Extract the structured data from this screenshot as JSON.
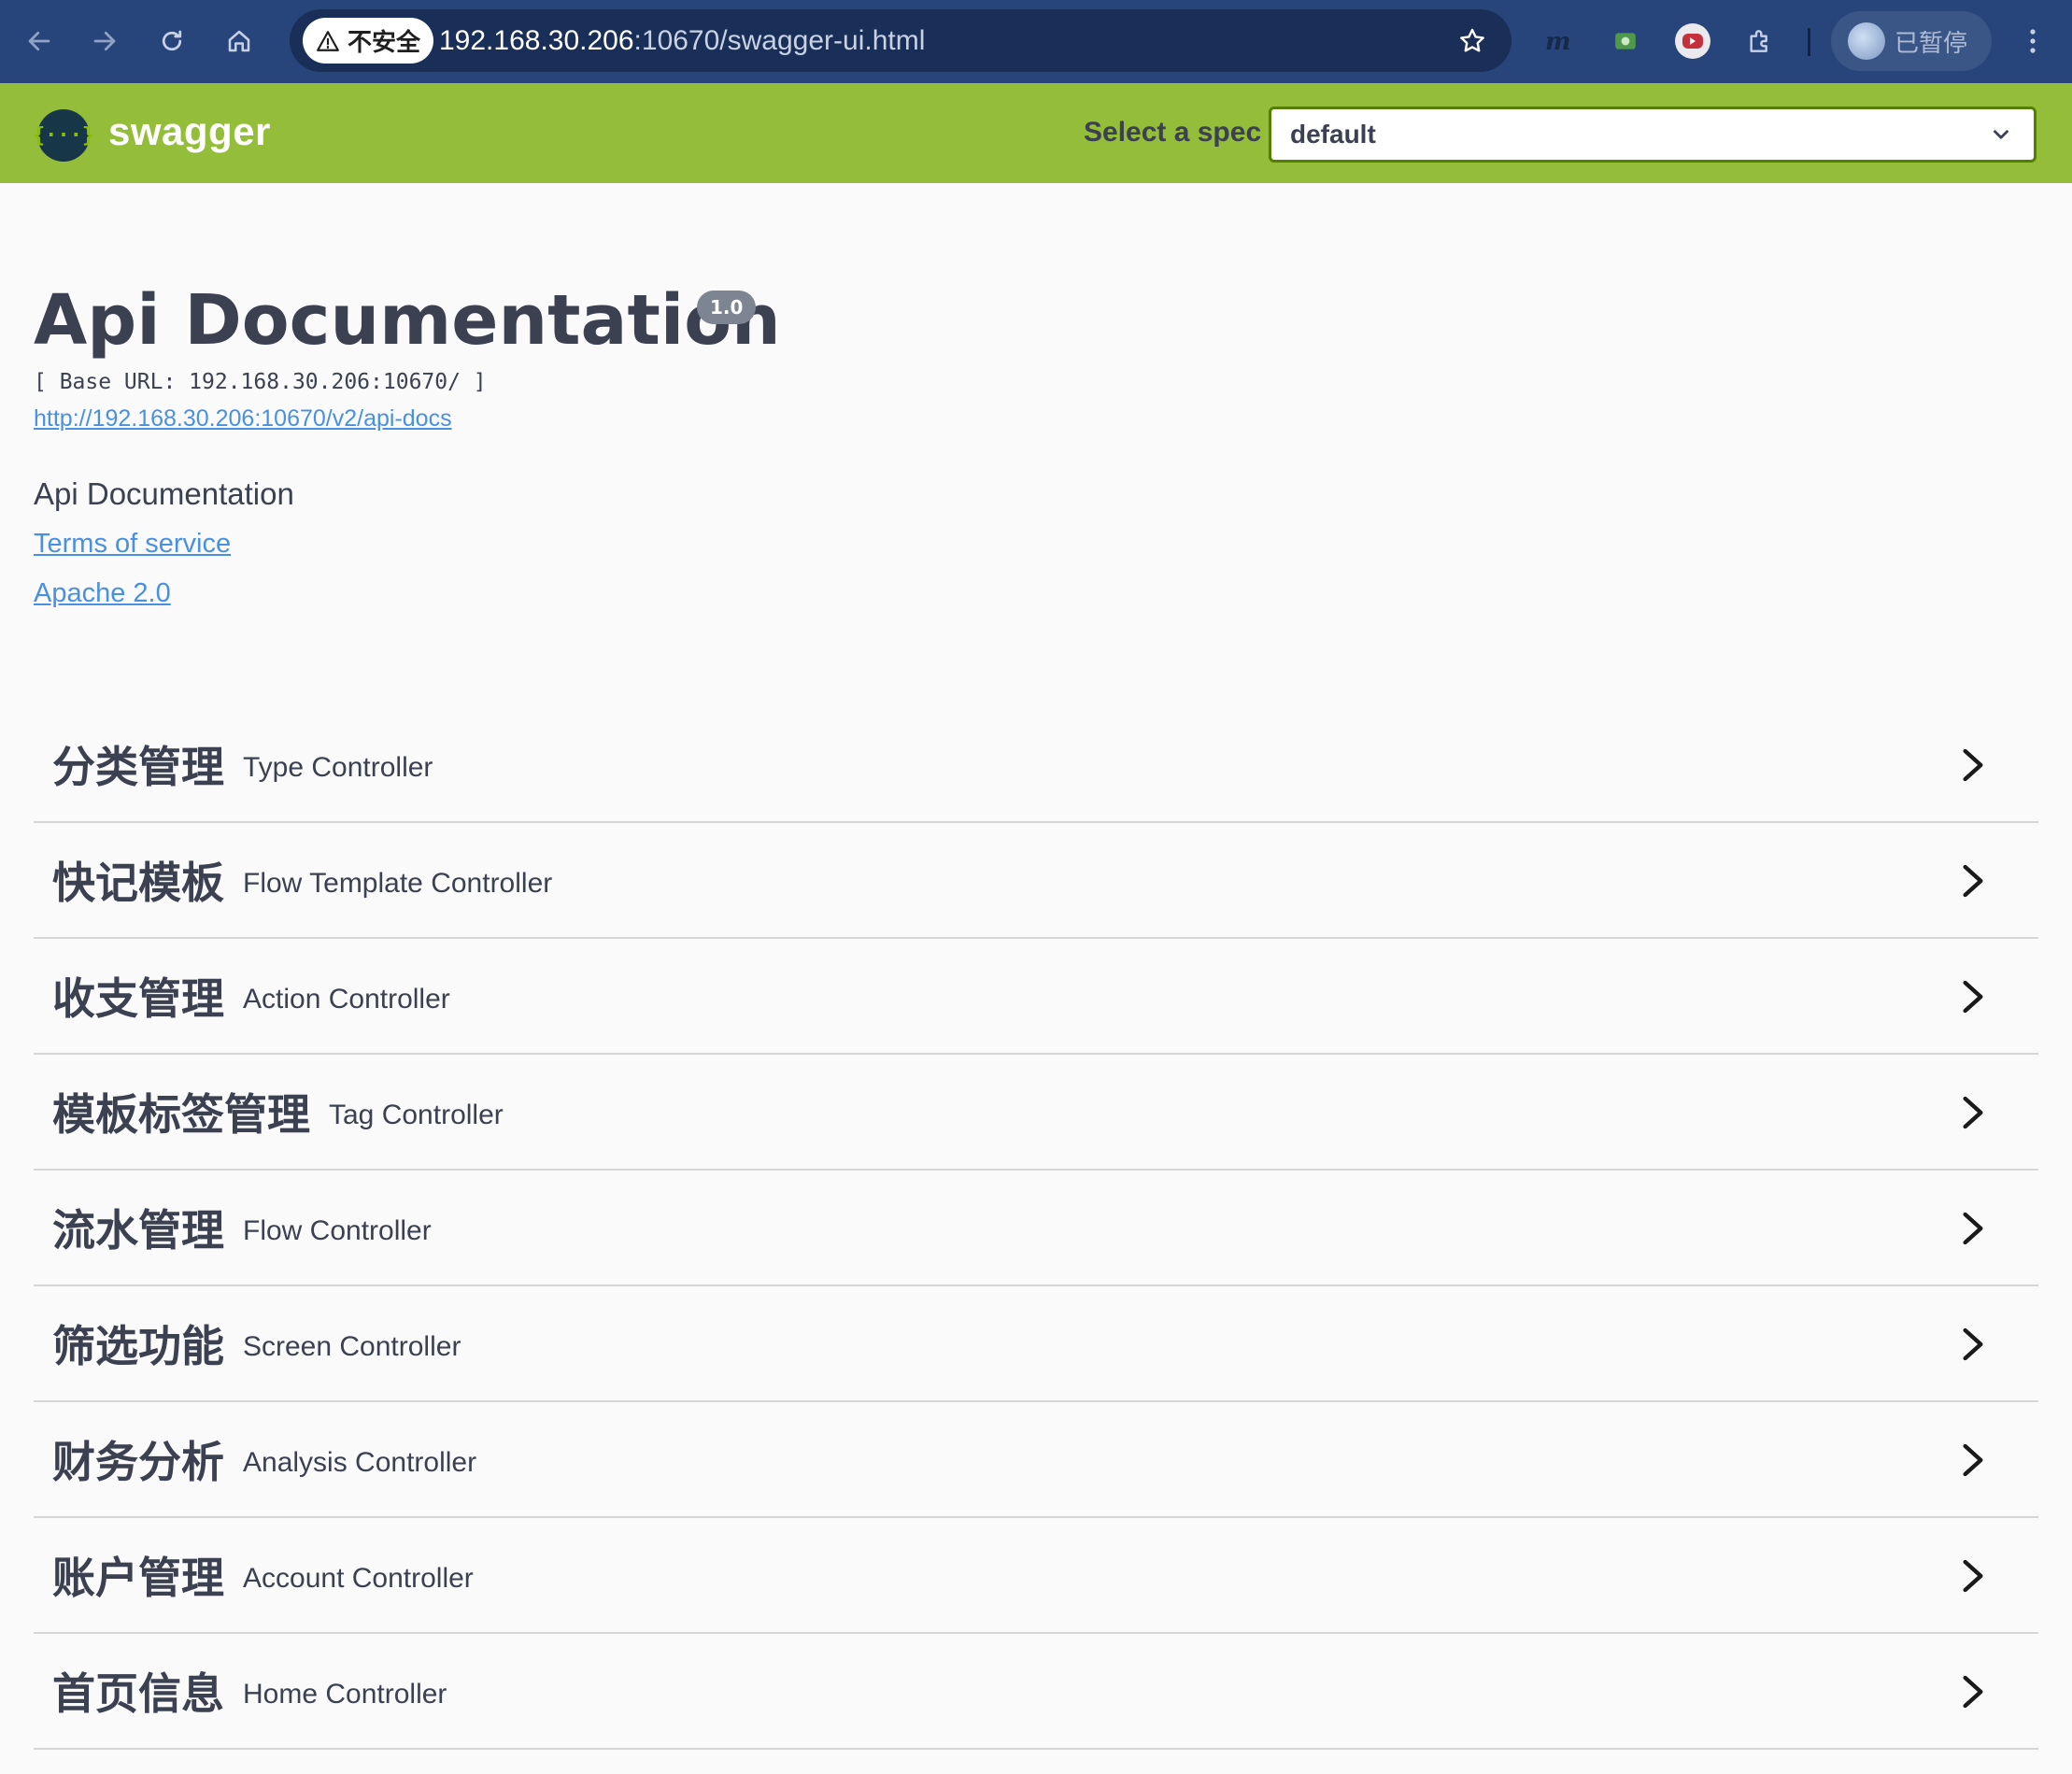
{
  "browser": {
    "security_label": "不安全",
    "url_host": "192.168.30.206",
    "url_rest": ":10670/swagger-ui.html",
    "profile_label": "已暂停"
  },
  "topbar": {
    "logo_glyph": "{···}",
    "logo_text": "swagger",
    "spec_label": "Select a spec",
    "spec_value": "default"
  },
  "info": {
    "title": "Api Documentation",
    "version": "1.0",
    "base_url": "[ Base URL: 192.168.30.206:10670/ ]",
    "api_docs_link": "http://192.168.30.206:10670/v2/api-docs",
    "description": "Api Documentation",
    "terms_link": "Terms of service",
    "license_link": "Apache 2.0"
  },
  "tags": [
    {
      "name": "分类管理",
      "description": "Type Controller"
    },
    {
      "name": "快记模板",
      "description": "Flow Template Controller"
    },
    {
      "name": "收支管理",
      "description": "Action Controller"
    },
    {
      "name": "模板标签管理",
      "description": "Tag Controller"
    },
    {
      "name": "流水管理",
      "description": "Flow Controller"
    },
    {
      "name": "筛选功能",
      "description": "Screen Controller"
    },
    {
      "name": "财务分析",
      "description": "Analysis Controller"
    },
    {
      "name": "账户管理",
      "description": "Account Controller"
    },
    {
      "name": "首页信息",
      "description": "Home Controller"
    }
  ],
  "colors": {
    "chrome_bg": "#27457a",
    "topbar_bg": "#94bd3a",
    "link": "#4990e2"
  }
}
